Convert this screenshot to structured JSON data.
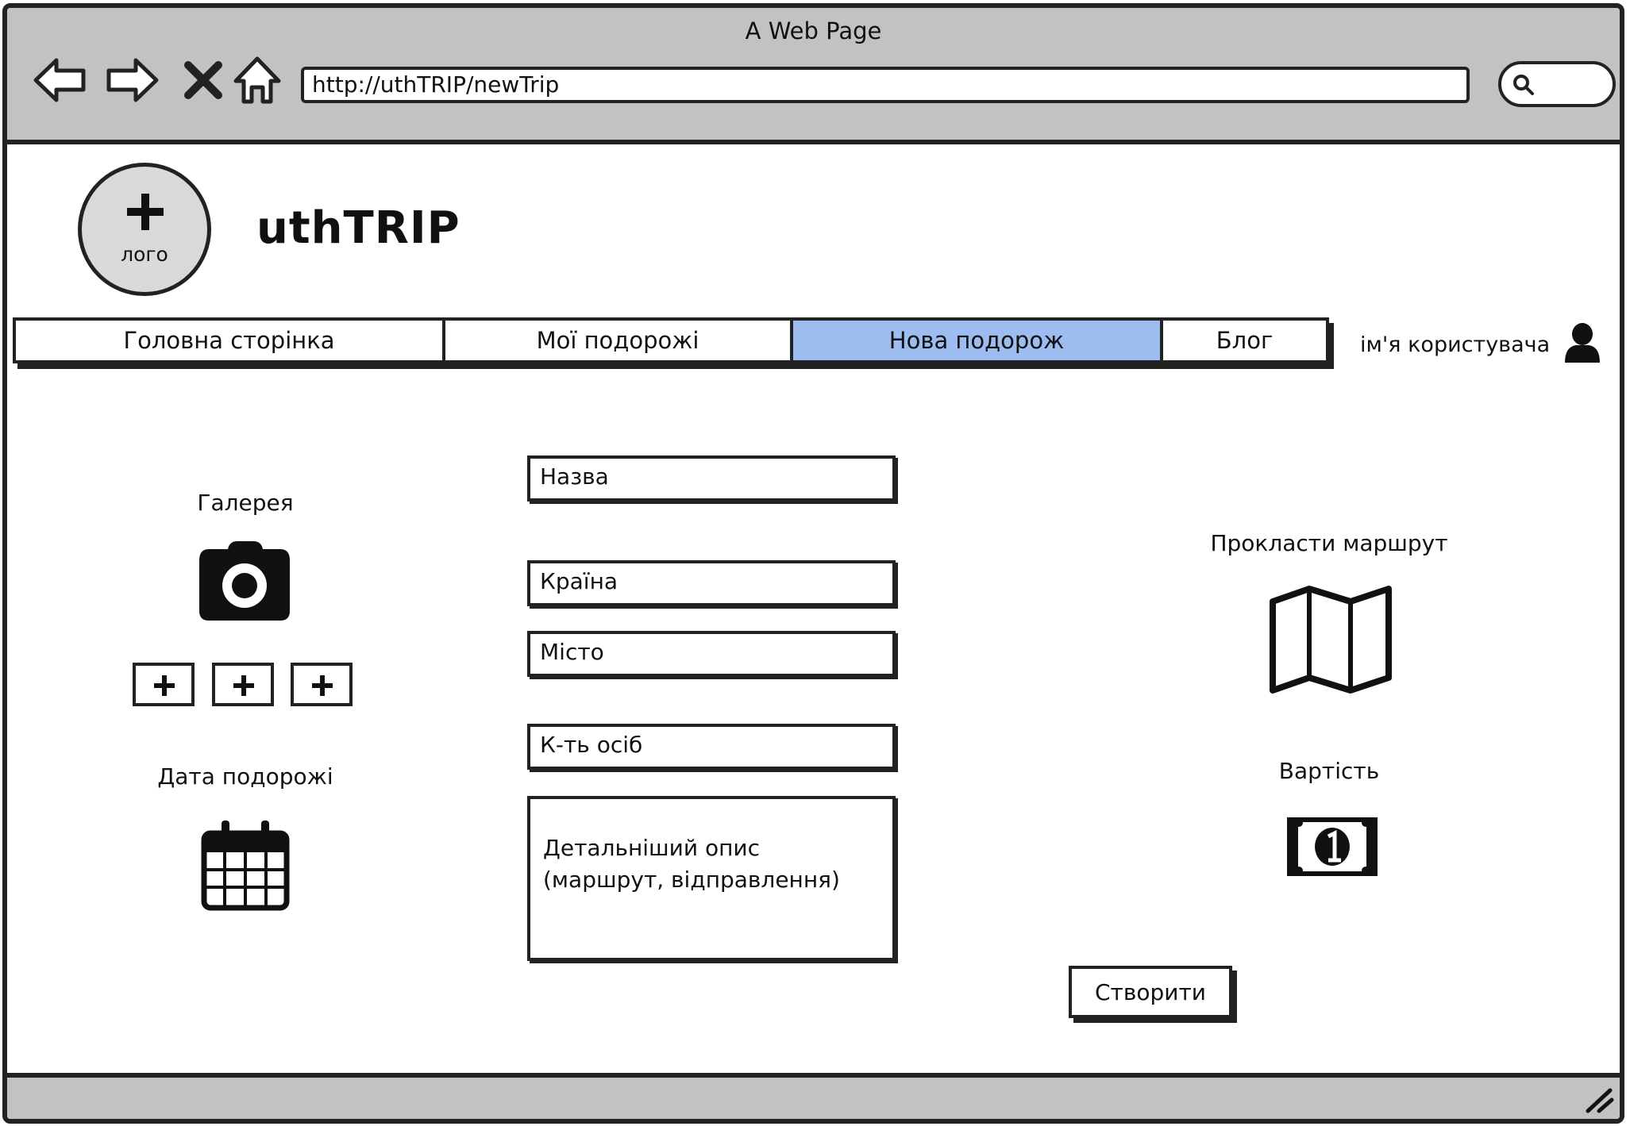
{
  "window": {
    "title": "A Web Page"
  },
  "browser": {
    "url": "http://uthTRIP/newTrip"
  },
  "site": {
    "logo_label": "лого",
    "title": "uthTRIP"
  },
  "nav": {
    "tabs": [
      {
        "label": "Головна сторінка"
      },
      {
        "label": "Мої подорожі"
      },
      {
        "label": "Нова подорож",
        "active": true
      },
      {
        "label": "Блог"
      }
    ],
    "user_name": "ім'я користувача"
  },
  "gallery": {
    "label": "Галерея"
  },
  "trip_date": {
    "label": "Дата подорожі"
  },
  "form": {
    "name_placeholder": "Назва",
    "country_placeholder": "Країна",
    "city_placeholder": "Місто",
    "people_placeholder": "К-ть осіб",
    "description_placeholder": "Детальніший опис\n(маршрут, відправлення)",
    "create_label": "Створити"
  },
  "route": {
    "label": "Прокласти маршрут"
  },
  "cost": {
    "label": "Вартість"
  },
  "colors": {
    "active_tab": "#9dbcf0",
    "chrome": "#c2c2c2"
  }
}
